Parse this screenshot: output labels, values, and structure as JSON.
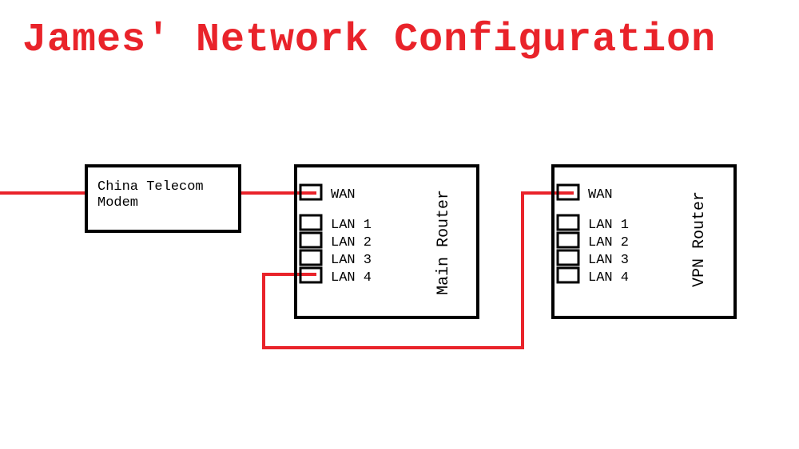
{
  "title": "James' Network Configuration",
  "modem": {
    "label": "China Telecom\nModem"
  },
  "router_main": {
    "name": "Main Router",
    "ports": [
      "WAN",
      "LAN 1",
      "LAN 2",
      "LAN 3",
      "LAN 4"
    ]
  },
  "router_vpn": {
    "name": "VPN Router",
    "ports": [
      "WAN",
      "LAN 1",
      "LAN 2",
      "LAN 3",
      "LAN 4"
    ]
  }
}
